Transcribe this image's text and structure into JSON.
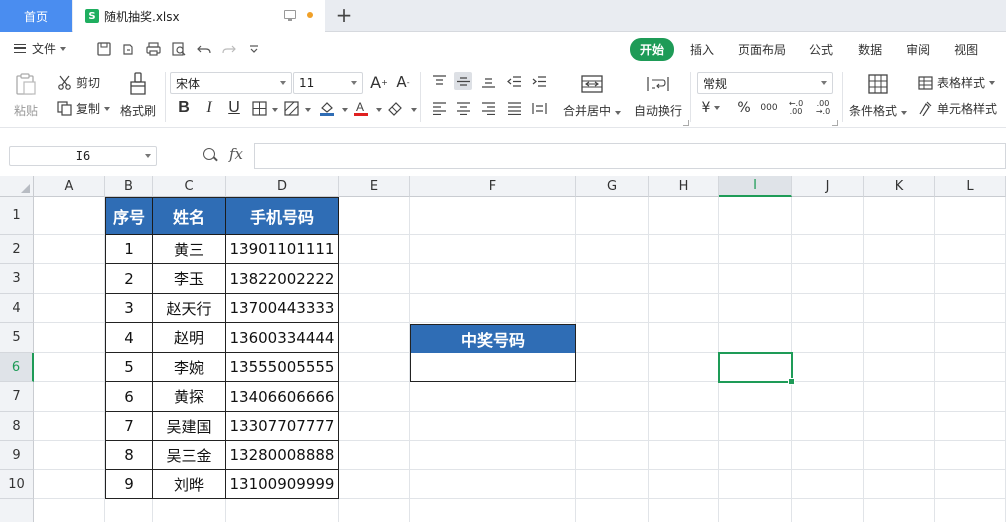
{
  "tabs": {
    "home": "首页",
    "file_name": "随机抽奖.xlsx"
  },
  "menu": {
    "file": "文件",
    "ribbon_tabs": [
      "开始",
      "插入",
      "页面布局",
      "公式",
      "数据",
      "审阅",
      "视图"
    ],
    "active_tab": "开始"
  },
  "ribbon": {
    "paste": "粘贴",
    "cut": "剪切",
    "copy": "复制",
    "format_painter": "格式刷",
    "font_name": "宋体",
    "font_size": "11",
    "merge_center": "合并居中",
    "wrap_text": "自动换行",
    "number_format": "常规",
    "conditional_format": "条件格式",
    "table_style": "表格样式",
    "cell_style": "单元格样式",
    "currency_symbol": "¥",
    "percent_symbol": "%",
    "thousands": "000",
    "inc_decimal": "←.0 .00",
    "dec_decimal": ".00 →.0",
    "bold": "B",
    "italic": "I",
    "underline": "U"
  },
  "formula_bar": {
    "name_box": "I6",
    "fx": "fx",
    "formula": ""
  },
  "sheet": {
    "columns": [
      "A",
      "B",
      "C",
      "D",
      "E",
      "F",
      "G",
      "H",
      "I",
      "J",
      "K",
      "L"
    ],
    "rows": [
      "1",
      "2",
      "3",
      "4",
      "5",
      "6",
      "7",
      "8",
      "9",
      "10"
    ],
    "selected_column": "I",
    "selected_row": "6",
    "table_headers": [
      "序号",
      "姓名",
      "手机号码"
    ],
    "table_rows": [
      [
        "1",
        "黄三",
        "13901101111"
      ],
      [
        "2",
        "李玉",
        "13822002222"
      ],
      [
        "3",
        "赵天行",
        "13700443333"
      ],
      [
        "4",
        "赵明",
        "13600334444"
      ],
      [
        "5",
        "李婉",
        "13555005555"
      ],
      [
        "6",
        "黄探",
        "13406606666"
      ],
      [
        "7",
        "吴建国",
        "13307707777"
      ],
      [
        "8",
        "吴三金",
        "13280008888"
      ],
      [
        "9",
        "刘晔",
        "13100909999"
      ]
    ],
    "prize_header": "中奖号码",
    "prize_value": ""
  },
  "colors": {
    "accent_green": "#1e9b57",
    "header_blue": "#2f6db5",
    "home_tab_blue": "#4a8df0"
  }
}
